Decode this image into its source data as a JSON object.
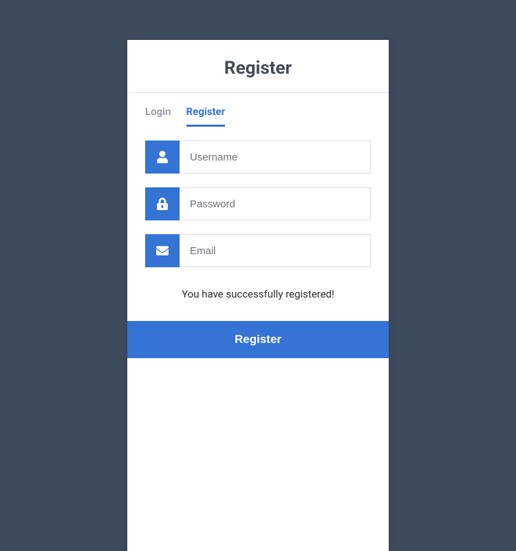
{
  "header": {
    "title": "Register"
  },
  "tabs": {
    "login": "Login",
    "register": "Register"
  },
  "form": {
    "username": {
      "placeholder": "Username",
      "value": ""
    },
    "password": {
      "placeholder": "Password",
      "value": ""
    },
    "email": {
      "placeholder": "Email",
      "value": ""
    }
  },
  "status_message": "You have successfully registered!",
  "submit_label": "Register",
  "colors": {
    "primary": "#3573d4",
    "background": "#3e4b5d"
  }
}
